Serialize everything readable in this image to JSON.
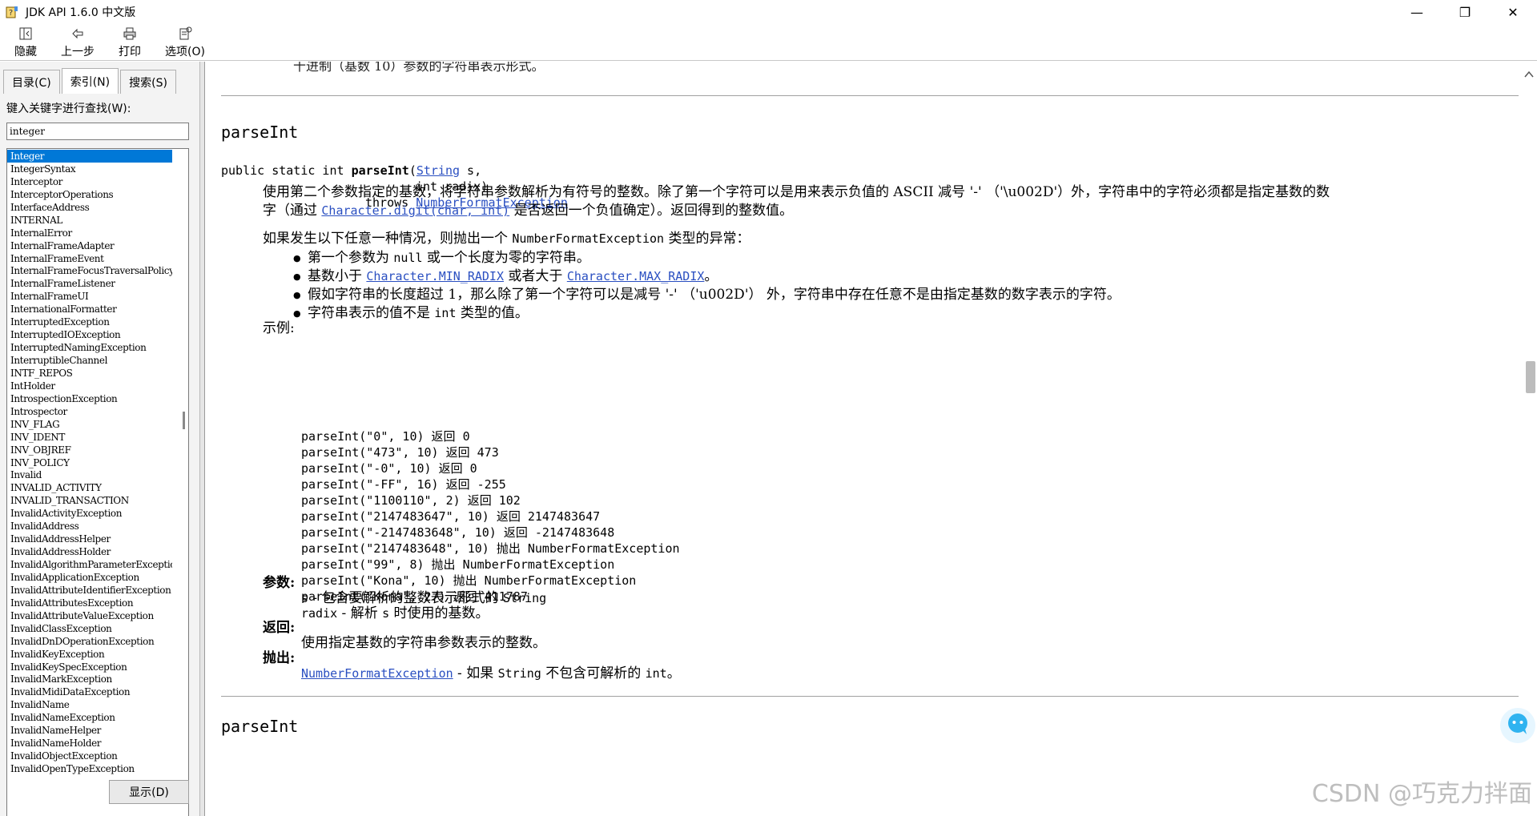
{
  "window": {
    "title": "JDK API 1.6.0 中文版",
    "controls": {
      "minimize": "—",
      "restore": "❐",
      "close": "✕"
    }
  },
  "toolbar": {
    "hide": "隐藏",
    "back": "上一步",
    "print": "打印",
    "options": "选项(O)"
  },
  "leftpane": {
    "tabs": [
      "目录(C)",
      "索引(N)",
      "搜索(S)"
    ],
    "search_label": "键入关键字进行查找(W):",
    "search_value": "integer",
    "items": [
      "Integer",
      "IntegerSyntax",
      "Interceptor",
      "InterceptorOperations",
      "InterfaceAddress",
      "INTERNAL",
      "InternalError",
      "InternalFrameAdapter",
      "InternalFrameEvent",
      "InternalFrameFocusTraversalPolicy",
      "InternalFrameListener",
      "InternalFrameUI",
      "InternationalFormatter",
      "InterruptedException",
      "InterruptedIOException",
      "InterruptedNamingException",
      "InterruptibleChannel",
      "INTF_REPOS",
      "IntHolder",
      "IntrospectionException",
      "Introspector",
      "INV_FLAG",
      "INV_IDENT",
      "INV_OBJREF",
      "INV_POLICY",
      "Invalid",
      "INVALID_ACTIVITY",
      "INVALID_TRANSACTION",
      "InvalidActivityException",
      "InvalidAddress",
      "InvalidAddressHelper",
      "InvalidAddressHolder",
      "InvalidAlgorithmParameterException",
      "InvalidApplicationException",
      "InvalidAttributeIdentifierException",
      "InvalidAttributesException",
      "InvalidAttributeValueException",
      "InvalidClassException",
      "InvalidDnDOperationException",
      "InvalidKeyException",
      "InvalidKeySpecException",
      "InvalidMarkException",
      "InvalidMidiDataException",
      "InvalidName",
      "InvalidNameException",
      "InvalidNameHelper",
      "InvalidNameHolder",
      "InvalidObjectException",
      "InvalidOpenTypeException"
    ],
    "show_button": "显示(D)"
  },
  "content": {
    "prev_line": "十进制（基数 10）参数的字符串表示形式。",
    "method_title": "parseInt",
    "signature": {
      "line1_prefix": "public static int ",
      "method": "parseInt",
      "paren": "(",
      "type1": "String",
      "param1": " s,",
      "line2": "int radix)",
      "throws": "throws ",
      "exception": "NumberFormatException"
    },
    "desc": {
      "a": "使用第二个参数指定的基数，将字符串参数解析为有符号的整数。除了第一个字符可以是用来表示负值的 ASCII 减号 '-' （'\\u002D'）外，字符串中的字符必须都是指定基数的数",
      "b1": "字（通过 ",
      "b_link": "Character.digit(char, int)",
      "b2": " 是否返回一个负值确定）。返回得到的整数值。"
    },
    "throws_intro": {
      "a": "如果发生以下任意一种情况，则抛出一个 ",
      "code": "NumberFormatException",
      "b": " 类型的异常："
    },
    "bullets": {
      "b1_a": "第一个参数为 ",
      "b1_code": "null",
      "b1_b": " 或一个长度为零的字符串。",
      "b2_a": "基数小于 ",
      "b2_link1": "Character.MIN_RADIX",
      "b2_b": " 或者大于 ",
      "b2_link2": "Character.MAX_RADIX",
      "b2_c": "。",
      "b3": "假如字符串的长度超过 1，那么除了第一个字符可以是减号 '-' （'u002D'） 外，字符串中存在任意不是由指定基数的数字表示的字符。",
      "b4_a": "字符串表示的值不是 ",
      "b4_code": "int",
      "b4_b": " 类型的值。"
    },
    "example_label": "示例:",
    "examples": [
      "parseInt(\"0\", 10) 返回 0",
      "parseInt(\"473\", 10) 返回 473",
      "parseInt(\"-0\", 10) 返回 0",
      "parseInt(\"-FF\", 16) 返回 -255",
      "parseInt(\"1100110\", 2) 返回 102",
      "parseInt(\"2147483647\", 10) 返回 2147483647",
      "parseInt(\"-2147483648\", 10) 返回 -2147483648",
      "parseInt(\"2147483648\", 10) 抛出 NumberFormatException",
      "parseInt(\"99\", 8) 抛出 NumberFormatException",
      "parseInt(\"Kona\", 10) 抛出 NumberFormatException",
      "parseInt(\"Kona\", 27) 返回 411787"
    ],
    "params_label": "参数:",
    "param_s": {
      "name": "s",
      "a": " - 包含要解析的整数表示形式的 ",
      "code": "String"
    },
    "param_radix": {
      "name": "radix",
      "a": " - 解析 ",
      "code": "s",
      "b": " 时使用的基数。"
    },
    "returns_label": "返回:",
    "returns_text": "使用指定基数的字符串参数表示的整数。",
    "throws_label": "抛出:",
    "throws_item": {
      "link": "NumberFormatException",
      "a": " - 如果 ",
      "code": "String",
      "b": " 不包含可解析的 ",
      "code2": "int",
      "c": "。"
    },
    "next_title": "parseInt"
  },
  "watermark": "CSDN @巧克力拌面",
  "colors": {
    "link": "#2a4fc1",
    "selection": "#0078d7"
  }
}
